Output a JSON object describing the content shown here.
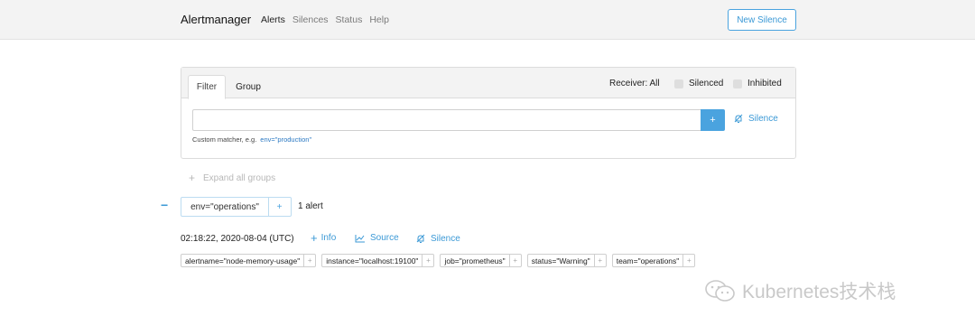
{
  "navbar": {
    "brand": "Alertmanager",
    "links": [
      "Alerts",
      "Silences",
      "Status",
      "Help"
    ],
    "new_silence_label": "New Silence"
  },
  "filter": {
    "tabs": [
      "Filter",
      "Group"
    ],
    "receiver_label": "Receiver: All",
    "silenced_label": "Silenced",
    "inhibited_label": "Inhibited",
    "input_value": "",
    "add_label": "+",
    "silence_label": "Silence",
    "hint_text": "Custom matcher, e.g.",
    "hint_example": "env=\"production\""
  },
  "expand_all_label": "Expand all groups",
  "group": {
    "collapse_symbol": "−",
    "label": "env=\"operations\"",
    "add_symbol": "+",
    "count_text": "1 alert"
  },
  "alert": {
    "timestamp": "02:18:22, 2020-08-04 (UTC)",
    "info_label": "Info",
    "source_label": "Source",
    "silence_label": "Silence",
    "labels": [
      "alertname=\"node-memory-usage\"",
      "instance=\"localhost:19100\"",
      "job=\"prometheus\"",
      "status=\"Warning\"",
      "team=\"operations\""
    ],
    "label_plus": "+"
  },
  "watermark": "Kubernetes技术栈",
  "colors": {
    "accent": "#4aa3df",
    "navbar_bg": "#f3f3f3",
    "link": "#3b99d6"
  }
}
